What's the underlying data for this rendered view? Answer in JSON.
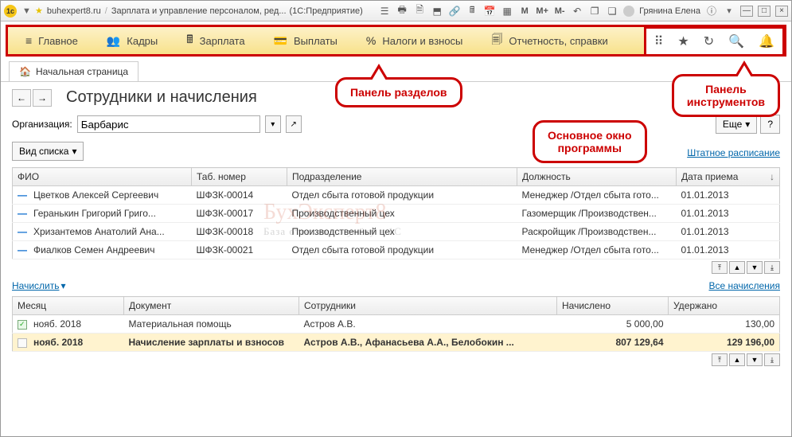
{
  "titlebar": {
    "site": "buhexpert8.ru",
    "doc": "Зарплата и управление персоналом, ред...",
    "app": "(1С:Предприятие)",
    "user": "Грянина Елена",
    "M": "M",
    "Mplus": "M+",
    "Mminus": "M-"
  },
  "sections": {
    "main": "Главное",
    "hr": "Кадры",
    "salary": "Зарплата",
    "payouts": "Выплаты",
    "taxes": "Налоги и взносы",
    "reports": "Отчетность, справки"
  },
  "tab_home": "Начальная страница",
  "page": {
    "title": "Сотрудники и начисления",
    "org_label": "Организация:",
    "org_value": "Барбарис",
    "more": "Еще",
    "list_mode": "Вид списка",
    "staff_link": "Штатное расписание",
    "accrue_link": "Начислить",
    "all_accr_link": "Все начисления"
  },
  "emp_cols": {
    "fio": "ФИО",
    "tab": "Таб. номер",
    "dept": "Подразделение",
    "pos": "Должность",
    "hired": "Дата приема"
  },
  "employees": [
    {
      "fio": "Цветков Алексей Сергеевич",
      "tab": "ШФЗК-00014",
      "dept": "Отдел сбыта готовой продукции",
      "pos": "Менеджер /Отдел сбыта гото...",
      "hired": "01.01.2013"
    },
    {
      "fio": "Геранькин Григорий Григо...",
      "tab": "ШФЗК-00017",
      "dept": "Производственный цех",
      "pos": "Газомерщик /Производствен...",
      "hired": "01.01.2013"
    },
    {
      "fio": "Хризантемов Анатолий Ана...",
      "tab": "ШФЗК-00018",
      "dept": "Производственный цех",
      "pos": "Раскройщик /Производствен...",
      "hired": "01.01.2013"
    },
    {
      "fio": "Фиалков Семен Андреевич",
      "tab": "ШФЗК-00021",
      "dept": "Отдел сбыта готовой продукции",
      "pos": "Менеджер /Отдел сбыта гото...",
      "hired": "01.01.2013"
    }
  ],
  "accr_cols": {
    "month": "Месяц",
    "doc": "Документ",
    "emp": "Сотрудники",
    "accrued": "Начислено",
    "withheld": "Удержано"
  },
  "accruals": [
    {
      "month": "нояб. 2018",
      "doc": "Материальная помощь",
      "emp": "Астров А.В.",
      "accrued": "5 000,00",
      "withheld": "130,00",
      "sel": false,
      "icon": "green"
    },
    {
      "month": "нояб. 2018",
      "doc": "Начисление зарплаты и взносов",
      "emp": "Астров А.В., Афанасьева А.А., Белобокин ...",
      "accrued": "807 129,64",
      "withheld": "129 196,00",
      "sel": true,
      "icon": "plain"
    }
  ],
  "callouts": {
    "sections": "Панель разделов",
    "mainwin": "Основное окно<br>программы",
    "tools": "Панель<br>инструментов"
  },
  "watermark": {
    "main": "БухЭксперт8",
    "sub": "База ответов по учёту в 1С"
  }
}
